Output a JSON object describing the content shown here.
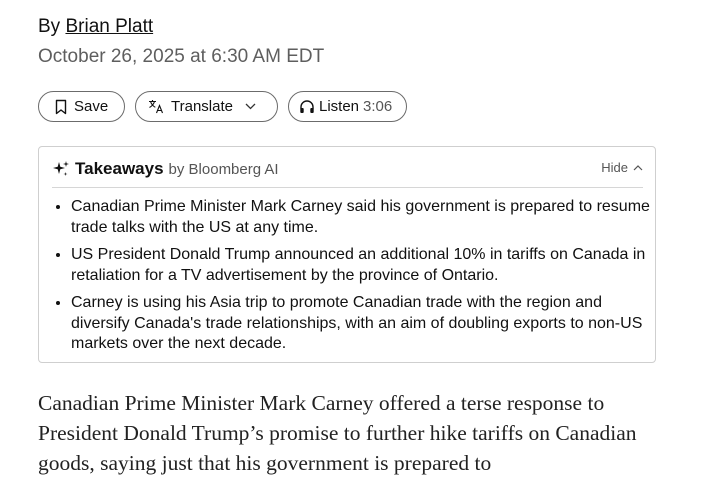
{
  "byline": {
    "prefix": "By",
    "author": "Brian Platt"
  },
  "dateline": "October 26, 2025 at 6:30 AM EDT",
  "actions": {
    "save_label": "Save",
    "translate_label": "Translate",
    "listen_label": "Listen",
    "listen_duration": "3:06",
    "icons": [
      "bookmark-icon",
      "translate-icon",
      "chevron-down-icon",
      "headphones-icon"
    ]
  },
  "takeaways": {
    "title": "Takeaways",
    "by_label": "by Bloomberg AI",
    "hide_label": "Hide",
    "items": [
      "Canadian Prime Minister Mark Carney said his government is prepared to resume trade talks with the US at any time.",
      "US President Donald Trump announced an additional 10% in tariffs on Canada in retaliation for a TV advertisement by the province of Ontario.",
      "Carney is using his Asia trip to promote Canadian trade with the region and diversify Canada's trade relationships, with an aim of doubling exports to non-US markets over the next decade."
    ]
  },
  "article": {
    "first_paragraph": "Canadian Prime Minister Mark Carney offered a terse response to President Donald Trump’s promise to further hike tariffs on Canadian goods, saying just that his government is prepared to"
  }
}
